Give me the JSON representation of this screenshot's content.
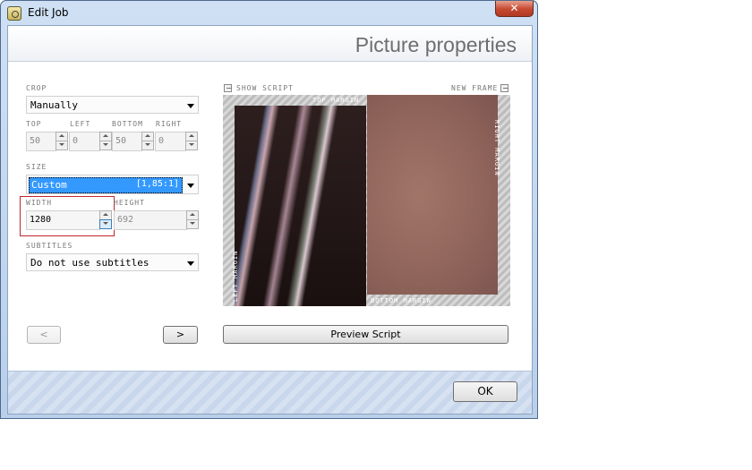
{
  "window": {
    "title": "Edit Job",
    "close_label": "✕"
  },
  "header": {
    "title": "Picture properties"
  },
  "crop": {
    "label": "CROP",
    "mode": "Manually",
    "fields": [
      {
        "label": "TOP",
        "value": "50"
      },
      {
        "label": "LEFT",
        "value": "0"
      },
      {
        "label": "BOTTOM",
        "value": "50"
      },
      {
        "label": "RIGHT",
        "value": "0"
      }
    ]
  },
  "size": {
    "label": "SIZE",
    "preset": "Custom",
    "ratio": "[1,85:1]",
    "width_label": "WIDTH",
    "width_value": "1280",
    "height_label": "HEIGHT",
    "height_value": "692"
  },
  "subtitles": {
    "label": "SUBTITLES",
    "value": "Do not use subtitles"
  },
  "nav": {
    "prev_label": "<",
    "next_label": ">"
  },
  "preview": {
    "show_script_label": "SHOW SCRIPT",
    "new_frame_label": "NEW FRAME",
    "top_margin": "TOP MARGIN",
    "bottom_margin": "BOTTOM MARGIN",
    "left_margin": "LEFT MARGIN",
    "right_margin": "RIGHT MARGIN",
    "preview_script_label": "Preview Script"
  },
  "footer": {
    "ok_label": "OK"
  },
  "colors": {
    "selection": "#3399ff",
    "highlight_border": "#c0272d",
    "title_gray": "#6e6e6e"
  },
  "icons": [
    "app-icon",
    "close-icon",
    "chevron-down-icon",
    "spin-up-icon",
    "spin-down-icon",
    "checkbox-icon"
  ]
}
